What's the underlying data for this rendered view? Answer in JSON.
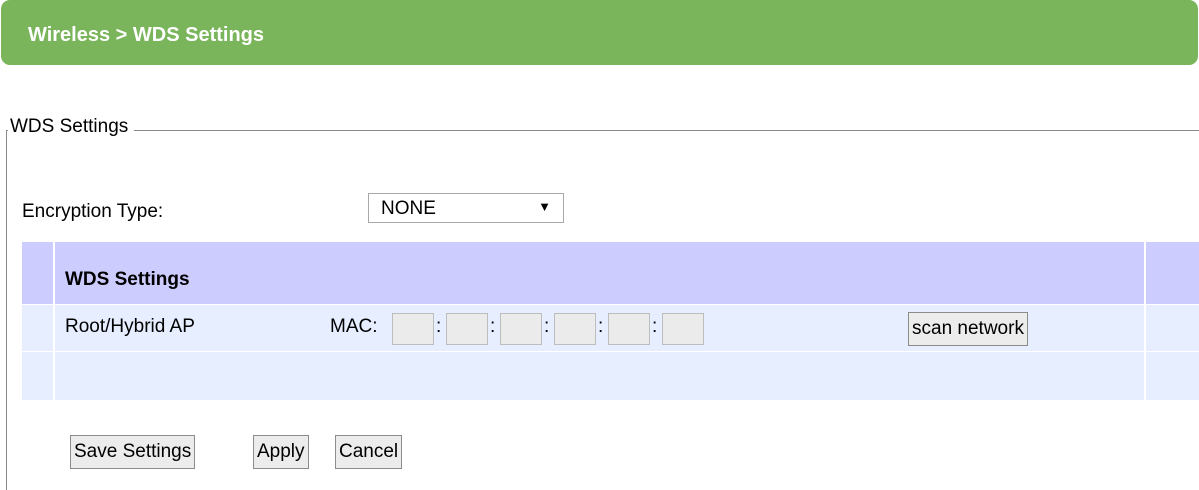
{
  "header": {
    "title": "Wireless > WDS Settings"
  },
  "section": {
    "legend": "WDS Settings"
  },
  "encryption": {
    "label": "Encryption Type:",
    "selected": "NONE",
    "arrow": "▼"
  },
  "table": {
    "heading": "WDS Settings",
    "row": {
      "label": "Root/Hybrid AP",
      "mac_label": "MAC:",
      "mac_separator": ":",
      "mac_octets": [
        "",
        "",
        "",
        "",
        "",
        ""
      ],
      "scan_label": "scan network"
    }
  },
  "buttons": {
    "save": "Save Settings",
    "apply": "Apply",
    "cancel": "Cancel"
  },
  "colors": {
    "header_bg": "#7ab55c",
    "table_head_bg": "#ccccff",
    "table_row_bg": "#e6eeff"
  }
}
